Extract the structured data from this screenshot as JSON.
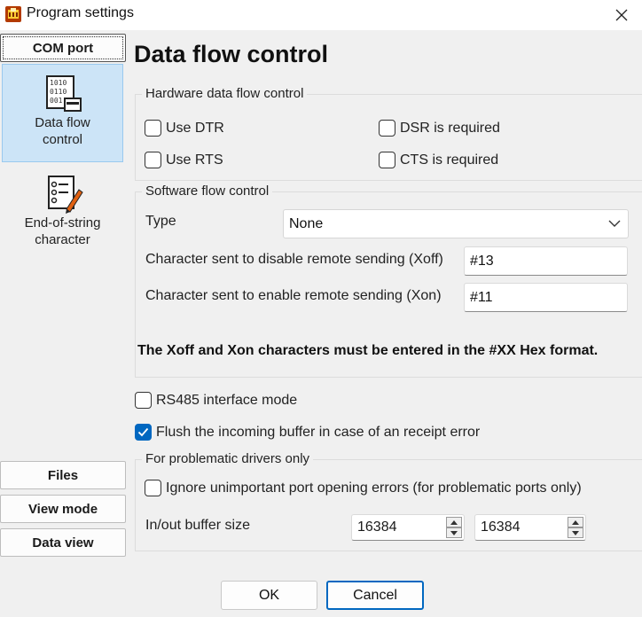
{
  "window": {
    "title": "Program settings",
    "icon": "app-icon"
  },
  "nav": {
    "com_port": "COM port",
    "items": [
      {
        "label_line1": "Data flow",
        "label_line2": "control",
        "icon": "binary-screen-icon",
        "selected": true
      },
      {
        "label_line1": "End-of-string",
        "label_line2": "character",
        "icon": "checklist-pen-icon",
        "selected": false
      }
    ],
    "files": "Files",
    "view_mode": "View mode",
    "data_view": "Data view"
  },
  "page": {
    "title": "Data flow control",
    "hardware": {
      "legend": "Hardware data flow control",
      "use_dtr": {
        "label": "Use DTR",
        "checked": false
      },
      "use_rts": {
        "label": "Use RTS",
        "checked": false
      },
      "dsr_required": {
        "label": "DSR is required",
        "checked": false
      },
      "cts_required": {
        "label": "CTS is required",
        "checked": false
      }
    },
    "software": {
      "legend": "Software flow control",
      "type_label": "Type",
      "type_value": "None",
      "xoff_label": "Character sent to disable remote sending (Xoff)",
      "xoff_value": "#13",
      "xon_label": "Character sent to enable remote sending (Xon)",
      "xon_value": "#11"
    },
    "note": "The Xoff and Xon characters must be entered in the #XX Hex format.",
    "rs485": {
      "label": "RS485 interface mode",
      "checked": false
    },
    "flush": {
      "label": "Flush the incoming buffer in case of an receipt error",
      "checked": true
    },
    "problematic": {
      "legend": "For problematic drivers only",
      "ignore_errors": {
        "label": "Ignore unimportant port opening errors (for problematic ports only)",
        "checked": false
      },
      "buffer_label": "In/out buffer size",
      "buffer_in": "16384",
      "buffer_out": "16384"
    }
  },
  "buttons": {
    "ok": "OK",
    "cancel": "Cancel"
  },
  "colors": {
    "accent": "#0067c0",
    "selection": "#cce4f7"
  }
}
